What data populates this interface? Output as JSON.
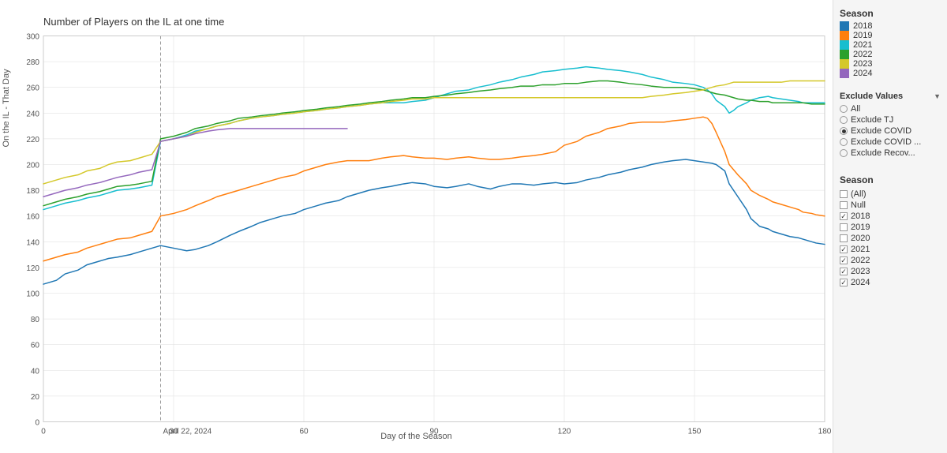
{
  "chart": {
    "title": "Number of Players on the IL at one time",
    "y_axis_label": "On the IL - That Day",
    "x_axis_label": "Day of the Season",
    "y_min": 0,
    "y_max": 300,
    "y_ticks": [
      0,
      20,
      40,
      60,
      80,
      100,
      120,
      140,
      160,
      180,
      200,
      220,
      240,
      260,
      280,
      300
    ],
    "x_ticks": [
      0,
      30,
      60,
      90,
      120,
      150,
      180
    ],
    "annotation_label": "April 22, 2024",
    "annotation_x": 27
  },
  "legend": {
    "title": "Season",
    "items": [
      {
        "label": "2018",
        "color": "#1f77b4"
      },
      {
        "label": "2019",
        "color": "#ff7f0e"
      },
      {
        "label": "2021",
        "color": "#17becf"
      },
      {
        "label": "2022",
        "color": "#2ca02c"
      },
      {
        "label": "2023",
        "color": "#d4c82a"
      },
      {
        "label": "2024",
        "color": "#9467bd"
      }
    ]
  },
  "exclude_filter": {
    "title": "Exclude Values",
    "options": [
      {
        "label": "All",
        "selected": false
      },
      {
        "label": "Exclude TJ",
        "selected": false
      },
      {
        "label": "Exclude COVID",
        "selected": true
      },
      {
        "label": "Exclude COVID ...",
        "selected": false
      },
      {
        "label": "Exclude Recov...",
        "selected": false
      }
    ]
  },
  "season_filter": {
    "title": "Season",
    "options": [
      {
        "label": "(All)",
        "checked": false
      },
      {
        "label": "Null",
        "checked": false
      },
      {
        "label": "2018",
        "checked": true
      },
      {
        "label": "2019",
        "checked": false
      },
      {
        "label": "2020",
        "checked": false
      },
      {
        "label": "2021",
        "checked": true
      },
      {
        "label": "2022",
        "checked": true
      },
      {
        "label": "2023",
        "checked": true
      },
      {
        "label": "2024",
        "checked": true
      }
    ]
  }
}
